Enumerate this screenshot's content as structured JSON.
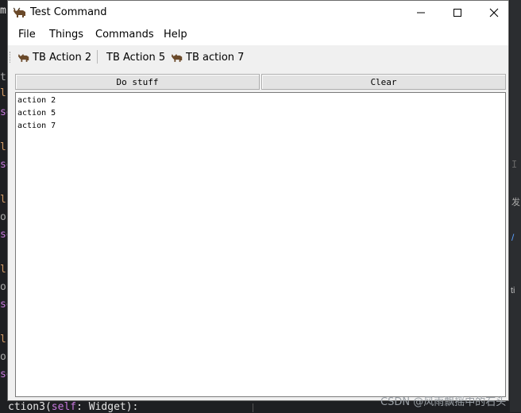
{
  "background": {
    "code_fragments": [
      {
        "text": "m",
        "kind": "keyword"
      },
      {
        "text": "t",
        "kind": "plain"
      },
      {
        "text": "lc",
        "kind": "keyword"
      },
      {
        "text": "se",
        "kind": "keyword"
      },
      {
        "text": "lc",
        "kind": "keyword"
      },
      {
        "text": "se",
        "kind": "keyword"
      },
      {
        "text": "lc",
        "kind": "keyword"
      },
      {
        "text": "or",
        "kind": "plain"
      },
      {
        "text": "se",
        "kind": "keyword"
      },
      {
        "text": "lc",
        "kind": "keyword"
      },
      {
        "text": "or",
        "kind": "plain"
      },
      {
        "text": "se",
        "kind": "keyword"
      },
      {
        "text": "lc",
        "kind": "keyword"
      },
      {
        "text": "or",
        "kind": "plain"
      },
      {
        "text": "se",
        "kind": "keyword"
      }
    ],
    "bottom_code": "ction3(",
    "bottom_code_kw": "self",
    "bottom_code_rest": ": Widget):",
    "right_fragments": [
      "I",
      "发",
      "/",
      "ti"
    ]
  },
  "window": {
    "title": "Test Command",
    "icon": "yak-icon",
    "controls": {
      "minimize": "minimize-icon",
      "maximize": "maximize-icon",
      "close": "close-icon"
    }
  },
  "menu": {
    "items": [
      "File",
      "Things",
      "Commands",
      "Help"
    ]
  },
  "toolbar": {
    "buttons": [
      {
        "label": "TB Action 2",
        "icon": "yak-icon"
      },
      {
        "label": "TB Action 5",
        "icon": null
      },
      {
        "label": "TB action 7",
        "icon": "yak-icon"
      }
    ]
  },
  "buttons": {
    "do_stuff": "Do stuff",
    "clear": "Clear"
  },
  "output": {
    "lines": [
      "action 2",
      "action 5",
      "action 7"
    ]
  },
  "watermark": "CSDN @风雨飘摇中的石头",
  "colors": {
    "window_bg": "#f0f0f0",
    "titlebar_bg": "#ffffff",
    "editor_bg": "#1e1f22",
    "keyword": "#c678dd",
    "accent": "#c7a34b"
  }
}
